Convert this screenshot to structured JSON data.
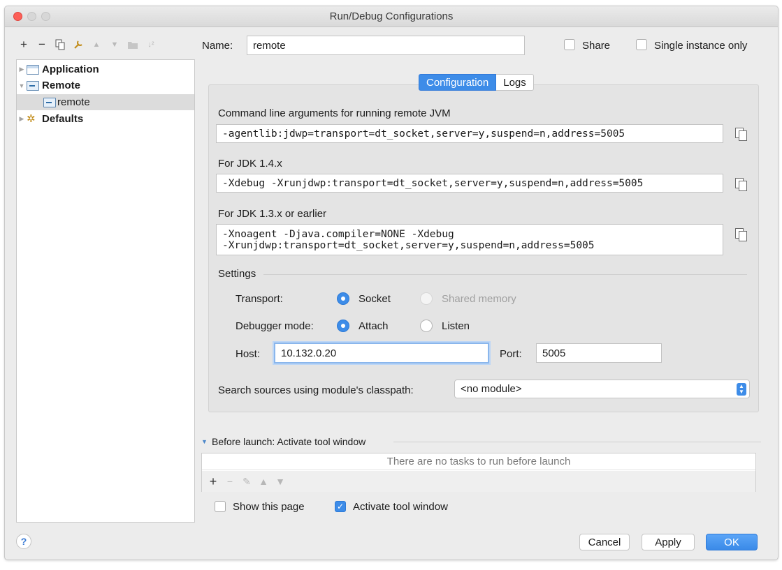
{
  "window": {
    "title": "Run/Debug Configurations"
  },
  "tree": {
    "items": [
      {
        "label": "Application"
      },
      {
        "label": "Remote"
      },
      {
        "label": "remote"
      },
      {
        "label": "Defaults"
      }
    ]
  },
  "header": {
    "name_label": "Name:",
    "name_value": "remote",
    "share_label": "Share",
    "single_instance_label": "Single instance only",
    "share_checked": false,
    "single_instance_checked": false
  },
  "tabs": [
    {
      "label": "Configuration",
      "active": true
    },
    {
      "label": "Logs",
      "active": false
    }
  ],
  "config": {
    "cmd_label": "Command line arguments for running remote JVM",
    "cmd_value": "-agentlib:jdwp=transport=dt_socket,server=y,suspend=n,address=5005",
    "jdk14_label": "For JDK 1.4.x",
    "jdk14_value": "-Xdebug -Xrunjdwp:transport=dt_socket,server=y,suspend=n,address=5005",
    "jdk13_label": "For JDK 1.3.x or earlier",
    "jdk13_line1": "-Xnoagent -Djava.compiler=NONE -Xdebug",
    "jdk13_line2": "-Xrunjdwp:transport=dt_socket,server=y,suspend=n,address=5005"
  },
  "settings": {
    "title": "Settings",
    "transport_label": "Transport:",
    "transport_options": [
      "Socket",
      "Shared memory"
    ],
    "transport_selected": "Socket",
    "mode_label": "Debugger mode:",
    "mode_options": [
      "Attach",
      "Listen"
    ],
    "mode_selected": "Attach",
    "host_label": "Host:",
    "host_value": "10.132.0.20",
    "port_label": "Port:",
    "port_value": "5005",
    "module_label": "Search sources using module's classpath:",
    "module_value": "<no module>"
  },
  "before_launch": {
    "title": "Before launch: Activate tool window",
    "empty_message": "There are no tasks to run before launch",
    "show_page_label": "Show this page",
    "show_page_checked": false,
    "activate_label": "Activate tool window",
    "activate_checked": true
  },
  "footer": {
    "help": "?",
    "cancel": "Cancel",
    "apply": "Apply",
    "ok": "OK"
  },
  "colors": {
    "accent": "#3d8ce8",
    "close": "#fc5f57"
  }
}
